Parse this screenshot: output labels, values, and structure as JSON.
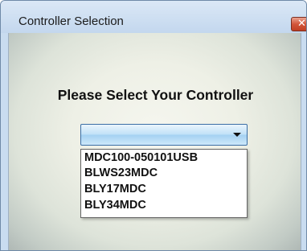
{
  "window": {
    "title": "Controller Selection",
    "close_icon": "close-icon"
  },
  "main": {
    "prompt": "Please Select Your Controller",
    "combo": {
      "selected_value": "",
      "options": [
        "MDC100-050101USB",
        "BLWS23MDC",
        "BLY17MDC",
        "BLY34MDC"
      ]
    }
  },
  "colors": {
    "titlebar": "#c9dcf0",
    "close_button": "#c94b31",
    "combo_highlight": "#a4d1f2"
  }
}
